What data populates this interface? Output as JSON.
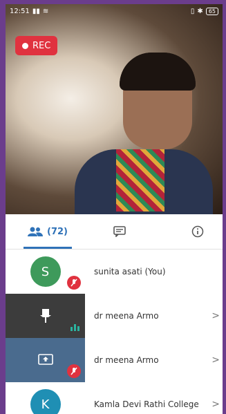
{
  "status": {
    "time": "12:51",
    "battery": "65"
  },
  "recording": {
    "label": "REC"
  },
  "tabs": {
    "people_count": "(72)"
  },
  "participants": [
    {
      "initial": "S",
      "name": "sunita asati (You)",
      "avatar_color": "#3e9a5b",
      "muted": true,
      "chevron": ""
    },
    {
      "initial": "",
      "name": "dr meena Armo",
      "avatar_color": "#3c3c3c",
      "muted": false,
      "chevron": ">"
    },
    {
      "initial": "",
      "name": "dr meena Armo",
      "avatar_color": "#4a6b8e",
      "muted": true,
      "chevron": ">"
    },
    {
      "initial": "K",
      "name": "Kamla Devi Rathi College",
      "avatar_color": "#1f8fb4",
      "muted": false,
      "chevron": ">"
    }
  ],
  "colors": {
    "accent": "#2f72b8",
    "rec": "#e0323f"
  }
}
